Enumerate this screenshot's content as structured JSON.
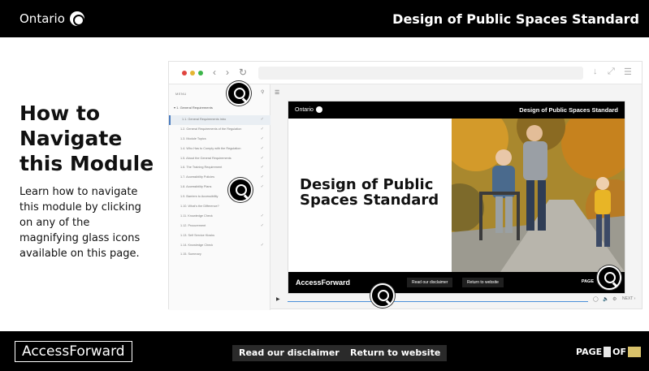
{
  "header": {
    "brand": "Ontario",
    "course_title": "Design of Public Spaces Standard"
  },
  "intro": {
    "heading": "How to Navigate this Module",
    "description": "Learn how to navigate this module by clicking on any of the magnifying glass icons available on this page."
  },
  "preview": {
    "menu": {
      "label": "MENU",
      "section": "1. General Requirements",
      "items": [
        {
          "label": "1.1. General Requirements Intro",
          "checked": true,
          "active": true
        },
        {
          "label": "1.2. General Requirements of the Regulation",
          "checked": true
        },
        {
          "label": "1.3. Module Topics",
          "checked": true
        },
        {
          "label": "1.4. Who Has to Comply with the Regulation",
          "checked": true
        },
        {
          "label": "1.5. About the General Requirements",
          "checked": true
        },
        {
          "label": "1.6. The Training Requirement",
          "checked": true
        },
        {
          "label": "1.7. Accessibility Policies",
          "checked": true
        },
        {
          "label": "1.8. Accessibility Plans",
          "checked": true
        },
        {
          "label": "1.9. Barriers to Accessibility",
          "checked": false
        },
        {
          "label": "1.10. What's the Difference?",
          "checked": false
        },
        {
          "label": "1.11. Knowledge Check",
          "checked": true
        },
        {
          "label": "1.12. Procurement",
          "checked": true
        },
        {
          "label": "1.13. Self Service Kiosks",
          "checked": false
        },
        {
          "label": "1.14. Knowledge Check",
          "checked": true
        },
        {
          "label": "1.15. Summary",
          "checked": false
        }
      ]
    },
    "slide": {
      "brand": "Ontario",
      "course_title": "Design of Public Spaces Standard",
      "title": "Design of Public Spaces Standard",
      "footer_brand": "AccessForward",
      "disclaimer_label": "Read our disclaimer",
      "return_label": "Return to website",
      "page_label": "PAGE"
    },
    "player": {
      "next_label": "NEXT"
    }
  },
  "footer": {
    "brand": "AccessForward",
    "disclaimer_label": "Read our disclaimer",
    "return_label": "Return to website",
    "page_label": "PAGE",
    "of_label": "OF"
  },
  "colors": {
    "bar_bg": "#000000",
    "progress": "#4a90d9",
    "page_total_highlight": "#d9c26b"
  },
  "icons": {
    "magnify": "magnifying-glass-icon",
    "logo": "trillium-icon"
  }
}
